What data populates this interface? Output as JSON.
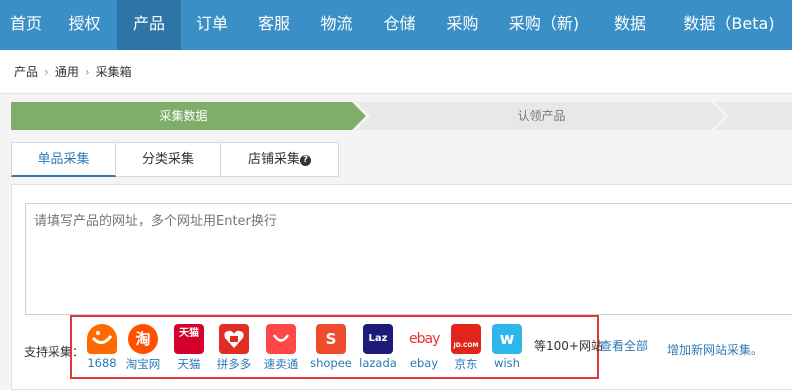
{
  "nav": {
    "items": [
      {
        "label": "首页",
        "active": false
      },
      {
        "label": "授权",
        "active": false
      },
      {
        "label": "产品",
        "active": true
      },
      {
        "label": "订单",
        "active": false
      },
      {
        "label": "客服",
        "active": false
      },
      {
        "label": "物流",
        "active": false
      },
      {
        "label": "仓储",
        "active": false
      },
      {
        "label": "采购",
        "active": false
      },
      {
        "label": "采购（新)",
        "active": false
      },
      {
        "label": "数据",
        "active": false
      },
      {
        "label": "数据（Beta)",
        "active": false
      }
    ]
  },
  "breadcrumb": [
    "产品",
    "通用",
    "采集箱"
  ],
  "steps": {
    "active": "采集数据",
    "next": "认领产品"
  },
  "tabs": [
    {
      "label": "单品采集",
      "active": true
    },
    {
      "label": "分类采集",
      "active": false
    },
    {
      "label": "店铺采集",
      "active": false,
      "help": true
    }
  ],
  "input": {
    "placeholder": "请填写产品的网址，多个网址用Enter换行"
  },
  "support": {
    "label": "支持采集：",
    "sites": [
      {
        "name": "1688",
        "logo_text": "1688",
        "icon": "alibaba-1688-icon"
      },
      {
        "name": "淘宝网",
        "logo_text": "淘",
        "icon": "taobao-icon"
      },
      {
        "name": "天猫",
        "logo_text": "天猫",
        "icon": "tmall-icon"
      },
      {
        "name": "拼多多",
        "logo_text": "",
        "icon": "pinduoduo-icon"
      },
      {
        "name": "速卖通",
        "logo_text": "",
        "icon": "aliexpress-icon"
      },
      {
        "name": "shopee",
        "logo_text": "S",
        "icon": "shopee-icon"
      },
      {
        "name": "lazada",
        "logo_text": "Laz",
        "icon": "lazada-icon"
      },
      {
        "name": "ebay",
        "logo_text": "ebay",
        "icon": "ebay-icon"
      },
      {
        "name": "京东",
        "logo_text": "JD.COM",
        "icon": "jd-icon"
      },
      {
        "name": "wish",
        "logo_text": "w",
        "icon": "wish-icon"
      }
    ],
    "more_text": "等100+网站",
    "view_all": "查看全部",
    "add_site": "增加新网站采集。"
  },
  "colors": {
    "nav_bg": "#3a8fc6",
    "nav_active": "#2e74a6",
    "step_active": "#7fae6b",
    "link": "#2d7ab7",
    "highlight": "#e03a3a"
  }
}
